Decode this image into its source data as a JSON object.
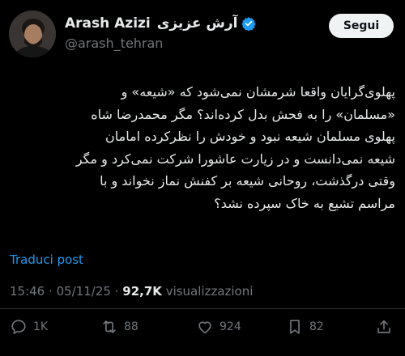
{
  "author": {
    "name": "Arash Azizi",
    "name_fa": "آرش عزیزی",
    "handle": "@arash_tehran"
  },
  "follow_label": "Segui",
  "tweet_lines": [
    "پهلوی‌گرایان واقعا شرمشان نمی‌شود که «شیعه» و",
    "«مسلمان» را به فحش بدل کرده‌اند؟ مگر محمدرضا شاه",
    "پهلوی مسلمان شیعه نبود و خودش را نظرکرده امامان",
    "شیعه نمی‌دانست و در زیارت عاشورا شرکت نمی‌کرد و مگر",
    "وقتی درگذشت، روحانی شیعه بر کفنش نماز نخواند و با",
    "مراسم تشیع به خاک سپرده نشد؟"
  ],
  "translate_label": "Traduci post",
  "meta": {
    "time": "15:46",
    "date": "05/11/25",
    "views_count": "92,7K",
    "views_label": "visualizzazioni"
  },
  "actions": {
    "replies": "1K",
    "reposts": "88",
    "likes": "924",
    "bookmarks": "82"
  },
  "colors": {
    "background": "#000000",
    "text": "#e7e9ea",
    "secondary": "#71767b",
    "link": "#1d9bf0",
    "verified": "#1d9bf0"
  }
}
